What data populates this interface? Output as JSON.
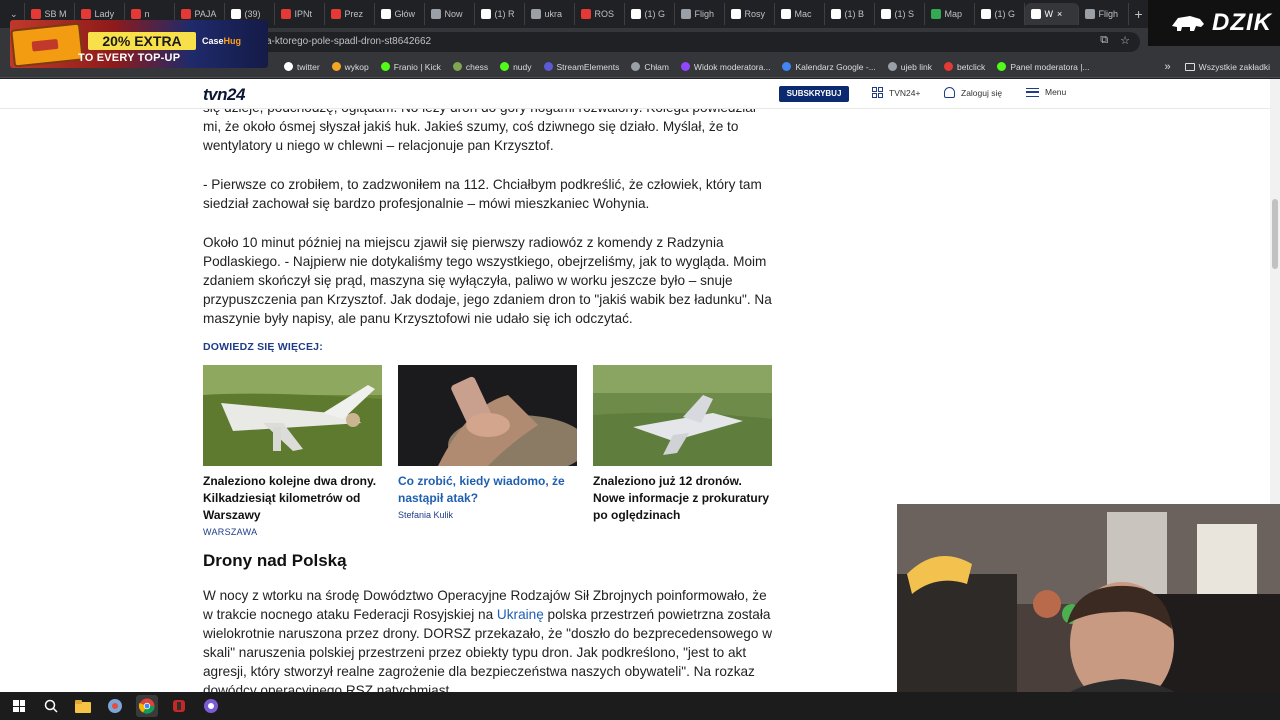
{
  "browser": {
    "tabs": [
      {
        "label": "SB M",
        "color": "#e53935"
      },
      {
        "label": "Lady",
        "color": "#e53935"
      },
      {
        "label": "n",
        "color": "#e53935"
      },
      {
        "label": "PAJA",
        "color": "#e53935"
      },
      {
        "label": "(39)",
        "color": "#ffffff"
      },
      {
        "label": "IPNt",
        "color": "#e53935"
      },
      {
        "label": "Prez",
        "color": "#e53935"
      },
      {
        "label": "Głów",
        "color": "#ffffff"
      },
      {
        "label": "Now",
        "color": "#9aa0a6"
      },
      {
        "label": "(1) R",
        "color": "#ffffff"
      },
      {
        "label": "ukra",
        "color": "#9aa0a6"
      },
      {
        "label": "ROS",
        "color": "#e53935"
      },
      {
        "label": "(1) G",
        "color": "#ffffff"
      },
      {
        "label": "Fligh",
        "color": "#9aa0a6"
      },
      {
        "label": "Rosy",
        "color": "#ffffff"
      },
      {
        "label": "Mac",
        "color": "#ffffff"
      },
      {
        "label": "(1) B",
        "color": "#ffffff"
      },
      {
        "label": "(1) S",
        "color": "#ffffff"
      },
      {
        "label": "Map",
        "color": "#34a853"
      },
      {
        "label": "(1) G",
        "color": "#ffffff"
      },
      {
        "label": "W",
        "color": "#ffffff",
        "active": true
      },
      {
        "label": "Fligh",
        "color": "#9aa0a6"
      }
    ],
    "new_tab": "+",
    "url": "a-ktorego-pole-spadl-dron-st8642662",
    "bookmarks": [
      {
        "label": "twitter",
        "color": "#ffffff"
      },
      {
        "label": "wykop",
        "color": "#f5a623"
      },
      {
        "label": "Franio | Kick",
        "color": "#53fc18"
      },
      {
        "label": "chess",
        "color": "#7fa650"
      },
      {
        "label": "nudy",
        "color": "#53fc18"
      },
      {
        "label": "StreamElements",
        "color": "#5b5bd6"
      },
      {
        "label": "Chłam",
        "color": "#9aa0a6"
      },
      {
        "label": "Widok moderatora...",
        "color": "#9146ff"
      },
      {
        "label": "Kalendarz Google -...",
        "color": "#4285f4"
      },
      {
        "label": "ujeb link",
        "color": "#9aa0a6"
      },
      {
        "label": "betclick",
        "color": "#e53935"
      },
      {
        "label": "Panel moderatora |...",
        "color": "#53fc18"
      }
    ],
    "more_bookmarks": "»",
    "all_bookmarks": "Wszystkie zakładki"
  },
  "ad": {
    "headline": "20% EXTRA",
    "subline": "TO EVERY TOP-UP",
    "brand_a": "Case",
    "brand_b": "Hug"
  },
  "overlay": {
    "brand": "DZIK"
  },
  "site": {
    "logo": "tvn24",
    "subscribe": "SUBSKRYBUJ",
    "tvn24plus": "TVN24+",
    "login": "Zaloguj się",
    "menu": "Menu"
  },
  "article": {
    "partial_top": "się dzieje, podchodzę, oglądam. No leży dron do góry nogami rozwalony. Kolega powiedział mi, że około ósmej słyszał jakiś huk. Jakieś szumy, coś dziwnego się działo. Myślał, że to wentylatory u niego w chlewni – relacjonuje pan Krzysztof.",
    "para2": "- Pierwsze co zrobiłem, to zadzwoniłem na 112. Chciałbym podkreślić, że człowiek, który tam siedział zachował się bardzo profesjonalnie – mówi mieszkaniec Wohynia.",
    "para3": "Około 10 minut później na miejscu zjawił się pierwszy radiowóz z komendy z Radzynia Podlaskiego. - Najpierw nie dotykaliśmy tego wszystkiego, obejrzeliśmy, jak to wygląda. Moim zdaniem skończył się prąd, maszyna się wyłączyła, paliwo w worku jeszcze było – snuje przypuszczenia pan Krzysztof. Jak dodaje, jego zdaniem dron to \"jakiś wabik bez ładunku\". Na maszynie były napisy, ale panu Krzysztofowi nie udało się ich odczytać.",
    "learn_more": "DOWIEDZ SIĘ WIĘCEJ:",
    "cards": [
      {
        "title": "Znaleziono kolejne dwa drony. Kilkadziesiąt kilometrów od Warszawy",
        "meta": "WARSZAWA"
      },
      {
        "title": "Co zrobić, kiedy wiadomo, że nastąpił atak?",
        "meta": "Stefania Kulik"
      },
      {
        "title": "Znaleziono już 12 dronów. Nowe informacje z prokuratury po oględzinach",
        "meta": ""
      }
    ],
    "section_heading": "Drony nad Polską",
    "para4_before": "W nocy z wtorku na środę Dowództwo Operacyjne Rodzajów Sił Zbrojnych poinformowało, że w trakcie nocnego ataku Federacji Rosyjskiej na ",
    "para4_link": "Ukrainę",
    "para4_after": " polska przestrzeń powietrzna została wielokrotnie naruszona przez drony. DORSZ przekazało, że \"doszło do bezprecedensowego w skali\" naruszenia polskiej przestrzeni przez obiekty typu dron. Jak podkreślono, \"jest to akt agresji, który stworzył realne zagrożenie dla bezpieczeństwa naszych obywateli\". Na rozkaz dowódcy operacyjnego RSZ natychmiast"
  }
}
